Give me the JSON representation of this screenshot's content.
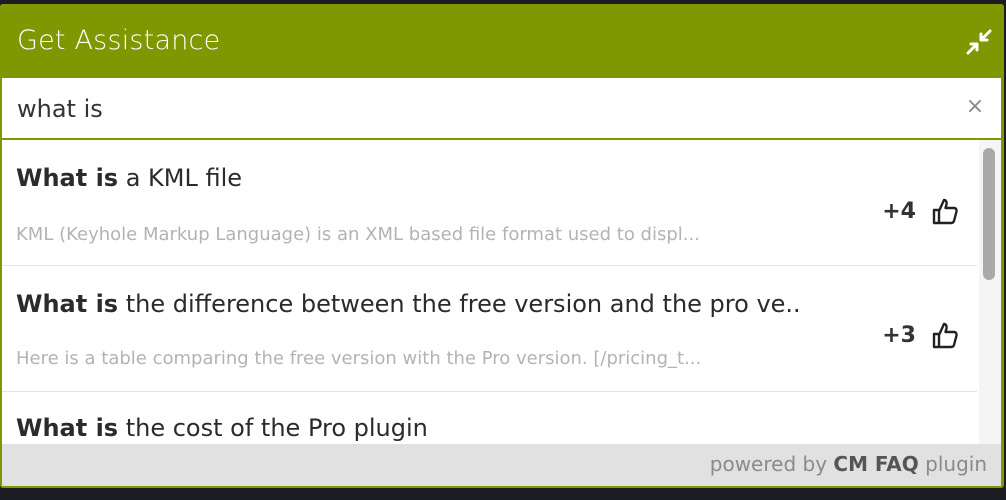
{
  "widget": {
    "title": "Get Assistance",
    "minimize_icon": "collapse-arrows-icon",
    "accent_color": "#7f9700"
  },
  "search": {
    "value": "what is",
    "clear_label": "×"
  },
  "results": [
    {
      "highlight": "What is",
      "rest": " a KML file",
      "excerpt": "KML (Keyhole Markup Language) is an XML based file format used to displ...",
      "votes": "+4"
    },
    {
      "highlight": "What is",
      "rest": " the difference between the free version and the pro ve..",
      "excerpt": "Here is a table comparing the free version with the Pro version. [/pricing_t...",
      "votes": "+3"
    },
    {
      "highlight": "What is",
      "rest": " the cost of the Pro plugin",
      "excerpt": "",
      "votes": ""
    }
  ],
  "footer": {
    "prefix": "powered by ",
    "brand": "CM FAQ",
    "suffix": " plugin"
  }
}
